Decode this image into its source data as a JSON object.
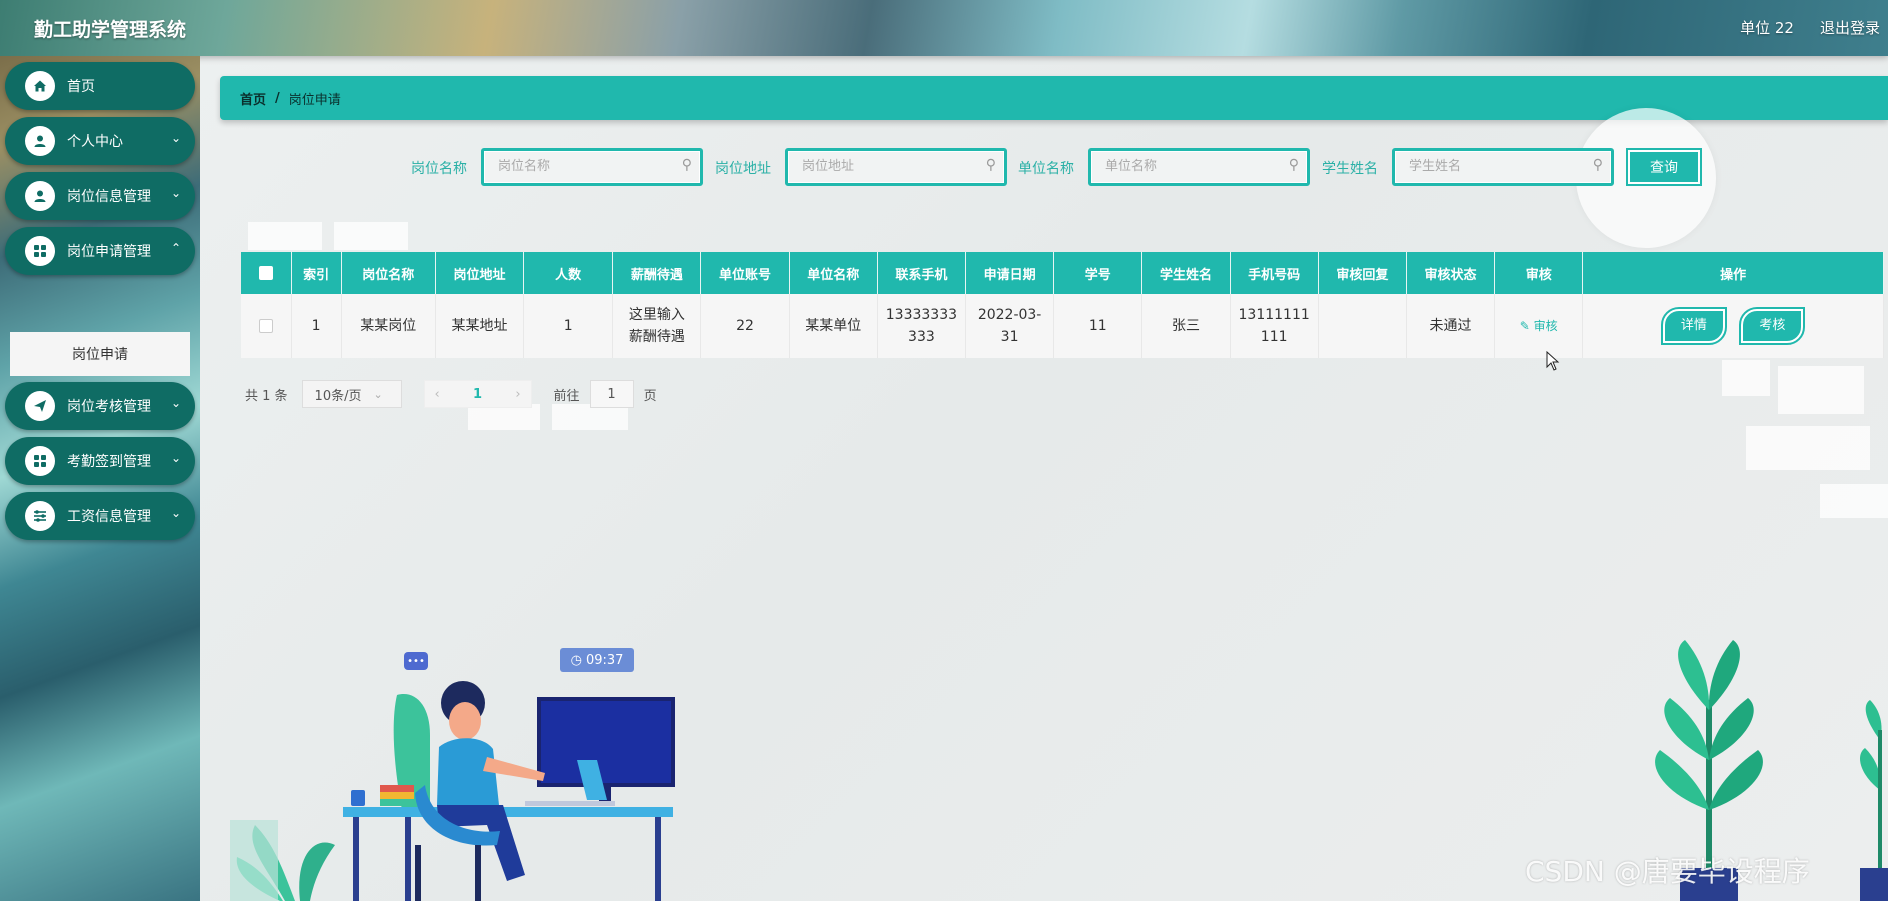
{
  "header": {
    "app_title": "勤工助学管理系统",
    "unit": "单位 22",
    "logout": "退出登录"
  },
  "sidebar": {
    "items": [
      {
        "label": "首页",
        "icon": "home-icon"
      },
      {
        "label": "个人中心",
        "icon": "user-icon"
      },
      {
        "label": "岗位信息管理",
        "icon": "user-icon"
      },
      {
        "label": "岗位申请管理",
        "icon": "grid-icon"
      },
      {
        "label": "岗位考核管理",
        "icon": "send-icon"
      },
      {
        "label": "考勤签到管理",
        "icon": "grid-icon"
      },
      {
        "label": "工资信息管理",
        "icon": "sliders-icon"
      }
    ],
    "active_sub": "岗位申请"
  },
  "breadcrumb": {
    "home": "首页",
    "separator": "/",
    "current": "岗位申请"
  },
  "search": {
    "fields": [
      {
        "label": "岗位名称",
        "placeholder": "岗位名称"
      },
      {
        "label": "岗位地址",
        "placeholder": "岗位地址"
      },
      {
        "label": "单位名称",
        "placeholder": "单位名称"
      },
      {
        "label": "学生姓名",
        "placeholder": "学生姓名"
      }
    ],
    "query_button": "查询"
  },
  "table": {
    "columns": [
      "索引",
      "岗位名称",
      "岗位地址",
      "人数",
      "薪酬待遇",
      "单位账号",
      "单位名称",
      "联系手机",
      "申请日期",
      "学号",
      "学生姓名",
      "手机号码",
      "审核回复",
      "审核状态",
      "审核",
      "操作"
    ],
    "rows": [
      {
        "index": "1",
        "job_name": "某某岗位",
        "job_address": "某某地址",
        "headcount": "1",
        "salary": "这里输入薪酬待遇",
        "unit_account": "22",
        "unit_name": "某某单位",
        "contact_phone": "13333333333",
        "apply_date": "2022-03-31",
        "student_no": "11",
        "student_name": "张三",
        "mobile": "13111111111",
        "audit_reply": "",
        "audit_status": "未通过",
        "audit_action": "审核",
        "detail_button": "详情",
        "assess_button": "考核"
      }
    ]
  },
  "pagination": {
    "total": "共 1 条",
    "page_size": "10条/页",
    "current_page": "1",
    "goto_prefix": "前往",
    "goto_value": "1",
    "goto_suffix": "页"
  },
  "illustration": {
    "clock_time": "09:37"
  },
  "watermark": "CSDN @唐要毕设程序",
  "colors": {
    "accent": "#20b8ad",
    "nav_bg": "#0f6c64"
  }
}
